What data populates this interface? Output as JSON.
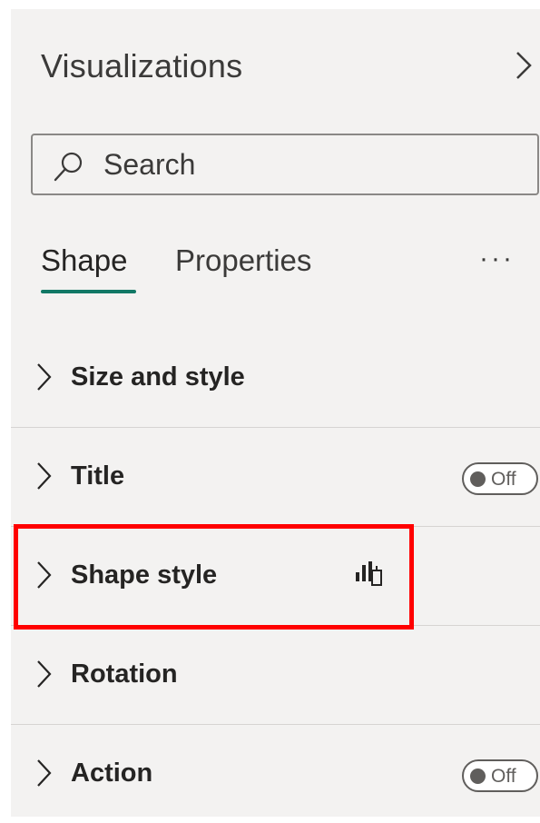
{
  "pane": {
    "title": "Visualizations",
    "collapse_icon": "chevron-right-icon"
  },
  "search": {
    "placeholder": "Search",
    "value": "",
    "icon": "search-icon"
  },
  "tabs": [
    {
      "label": "Shape",
      "active": true
    },
    {
      "label": "Properties",
      "active": false
    }
  ],
  "more_label": "···",
  "sections": [
    {
      "label": "Size and style",
      "expanded": false
    },
    {
      "label": "Title",
      "expanded": false,
      "toggle": "Off"
    },
    {
      "label": "Shape style",
      "expanded": false,
      "icon": "conditional-formatting-icon",
      "highlighted": true
    },
    {
      "label": "Rotation",
      "expanded": false
    },
    {
      "label": "Action",
      "expanded": false,
      "toggle": "Off"
    }
  ],
  "colors": {
    "accent": "#117865",
    "highlight": "#ff0000",
    "pane_bg": "#f3f2f1"
  }
}
